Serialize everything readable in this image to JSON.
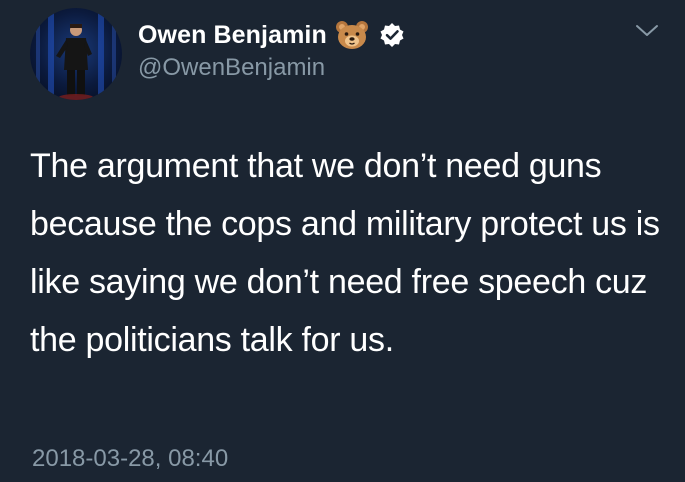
{
  "tweet": {
    "author": {
      "display_name": "Owen Benjamin",
      "handle": "@OwenBenjamin",
      "name_emoji": "bear-face-emoji",
      "verified_badge": "verified-check-icon"
    },
    "text": "The argument that we don’t need guns because the cops and military protect us is like saying we don’t need free speech cuz the politicians talk for us.",
    "timestamp": "2018-03-28, 08:40",
    "menu_icon": "chevron-down-icon"
  },
  "colors": {
    "background": "#1b2532",
    "primary_text": "#ffffff",
    "secondary_text": "#8899a6"
  }
}
